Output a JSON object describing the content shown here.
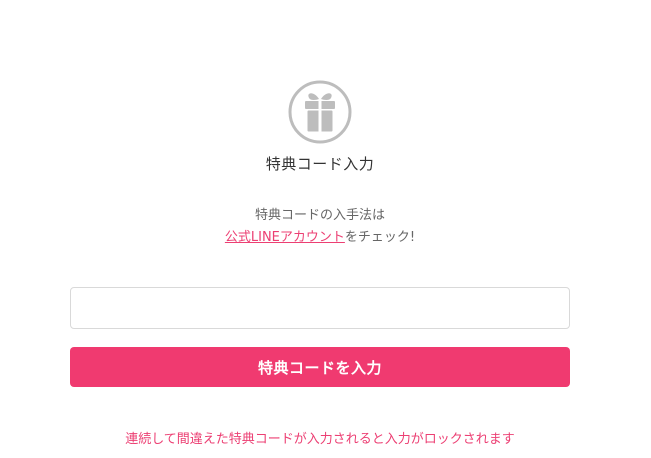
{
  "icon": {
    "name": "gift-icon",
    "color": "#bdbdbd"
  },
  "title": "特典コード入力",
  "hint": {
    "line1": "特典コードの入手法は",
    "link_text": "公式LINEアカウント",
    "line2_suffix": "をチェック!"
  },
  "code_input": {
    "value": "",
    "placeholder": ""
  },
  "submit_label": "特典コードを入力",
  "warning": "連続して間違えた特典コードが入力されると入力がロックされます",
  "colors": {
    "accent": "#f03a70",
    "link": "#ec3f73",
    "text": "#333333",
    "muted": "#666666",
    "border": "#d9d9d9"
  }
}
